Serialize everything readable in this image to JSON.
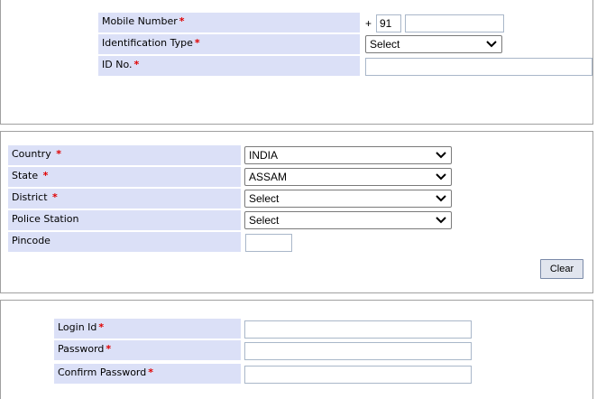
{
  "contact": {
    "mobile_label": "Mobile Number",
    "country_code_prefix": "+",
    "country_code": "91",
    "mobile_value": "",
    "id_type_label": "Identification Type",
    "id_type_selected": "Select",
    "id_no_label": "ID No.",
    "id_no_value": "",
    "required_mark": "*"
  },
  "address": {
    "country_label": "Country",
    "country_selected": "INDIA",
    "state_label": "State",
    "state_selected": "ASSAM",
    "district_label": "District",
    "district_selected": "Select",
    "police_station_label": "Police Station",
    "police_station_selected": "Select",
    "pincode_label": "Pincode",
    "pincode_value": "",
    "clear_button": "Clear"
  },
  "login": {
    "login_id_label": "Login Id",
    "password_label": "Password",
    "confirm_password_label": "Confirm Password",
    "login_id_value": "",
    "password_value": "",
    "confirm_password_value": ""
  },
  "icons": {
    "select_arrow": "chevron-down-icon"
  },
  "colors": {
    "label_background": "#dbe0f7",
    "required_star": "#e00000"
  }
}
